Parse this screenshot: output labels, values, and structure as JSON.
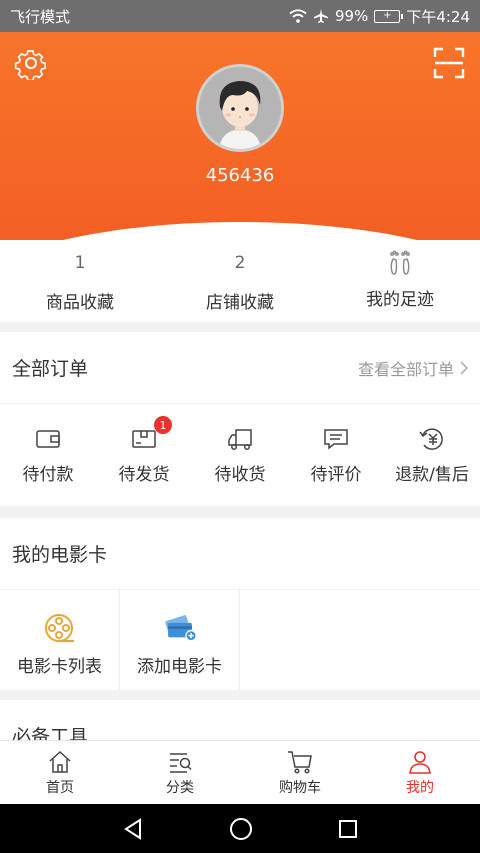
{
  "status_bar": {
    "mode": "飞行模式",
    "battery": "99%",
    "time": "下午4:24"
  },
  "profile": {
    "username": "456436"
  },
  "stats": [
    {
      "count": "1",
      "label": "商品收藏"
    },
    {
      "count": "2",
      "label": "店铺收藏"
    },
    {
      "count": "",
      "label": "我的足迹"
    }
  ],
  "orders": {
    "title": "全部订单",
    "view_all": "查看全部订单",
    "items": [
      {
        "label": "待付款",
        "icon": "wallet-icon"
      },
      {
        "label": "待发货",
        "icon": "package-icon",
        "badge": "1"
      },
      {
        "label": "待收货",
        "icon": "truck-icon"
      },
      {
        "label": "待评价",
        "icon": "comment-icon"
      },
      {
        "label": "退款/售后",
        "icon": "refund-icon"
      }
    ]
  },
  "movie_card": {
    "title": "我的电影卡",
    "items": [
      {
        "label": "电影卡列表",
        "icon": "film-reel-icon"
      },
      {
        "label": "添加电影卡",
        "icon": "add-card-icon"
      }
    ]
  },
  "tools": {
    "title": "必备工具"
  },
  "tabbar": [
    {
      "label": "首页",
      "icon": "home-icon"
    },
    {
      "label": "分类",
      "icon": "category-icon"
    },
    {
      "label": "购物车",
      "icon": "cart-icon"
    },
    {
      "label": "我的",
      "icon": "user-icon",
      "active": true
    }
  ],
  "colors": {
    "accent": "#f35f24",
    "active_tab": "#e8322b",
    "badge": "#e8322b"
  }
}
